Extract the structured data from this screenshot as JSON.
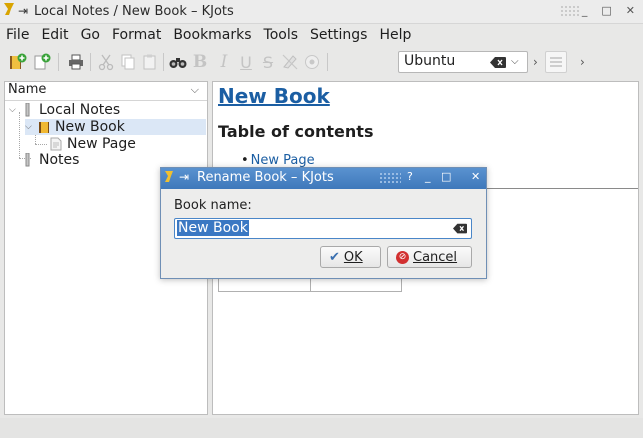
{
  "window": {
    "title": "Local Notes / New Book – KJots",
    "icons": {
      "app": "kjots-icon",
      "pin": "pin-icon",
      "minimize": "minimize-icon",
      "maximize": "maximize-icon",
      "close": "close-icon"
    }
  },
  "menu": [
    {
      "label": "File"
    },
    {
      "label": "Edit"
    },
    {
      "label": "Go"
    },
    {
      "label": "Format"
    },
    {
      "label": "Bookmarks"
    },
    {
      "label": "Tools"
    },
    {
      "label": "Settings"
    },
    {
      "label": "Help"
    }
  ],
  "toolbar": {
    "icons": [
      "new-book-icon",
      "new-page-icon",
      "print-icon",
      "cut-icon",
      "copy-icon",
      "paste-icon",
      "find-icon",
      "bold-icon",
      "italic-icon",
      "underline-icon",
      "strikethrough-icon",
      "clear-format-icon",
      "color-icon"
    ],
    "font_value": "Ubuntu",
    "colors": {
      "green": "#3aa33a",
      "gray": "#b5b5b5"
    }
  },
  "tree": {
    "header": "Name",
    "items": [
      {
        "label": "Local Notes",
        "level": 0,
        "expanded": true
      },
      {
        "label": "New Book",
        "level": 1,
        "expanded": true,
        "selected": true
      },
      {
        "label": "New Page",
        "level": 2
      },
      {
        "label": "Notes",
        "level": 0
      }
    ]
  },
  "content": {
    "heading": "New Book",
    "toc_title": "Table of contents",
    "toc_items": [
      "New Page"
    ],
    "link_color": "#1b5ea3"
  },
  "dialog": {
    "title": "Rename Book – KJots",
    "label": "Book name:",
    "input_value": "New Book",
    "ok_label": "OK",
    "cancel_label": "Cancel",
    "title_bar_color": "#4a85c6"
  }
}
